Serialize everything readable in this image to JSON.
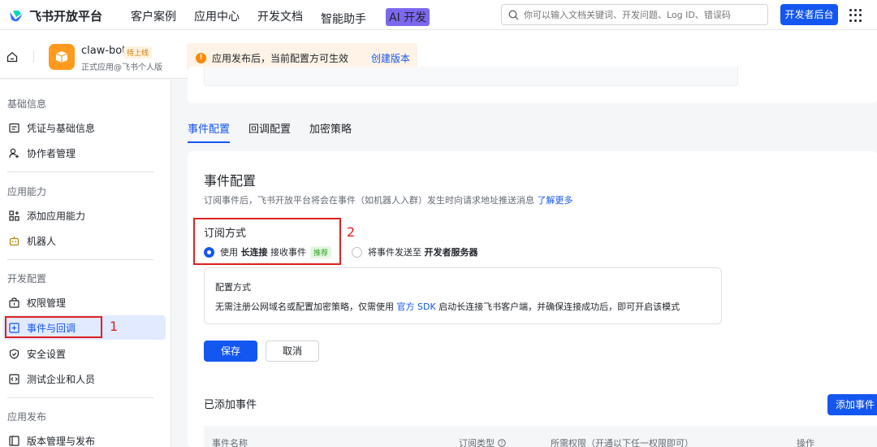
{
  "header": {
    "brand": "飞书开放平台",
    "nav": [
      "客户案例",
      "应用中心",
      "开发文档",
      "智能助手"
    ],
    "ai_badge": "AI 开发",
    "search_placeholder": "你可以输入文档关键词、开发问题、Log ID、错误码",
    "dev_console": "开发者后台"
  },
  "app": {
    "name": "claw-bot",
    "status": "待上线",
    "subtitle": "正式应用@飞书个人版",
    "notice": "应用发布后，当前配置方可生效",
    "notice_link": "创建版本"
  },
  "sidebar": {
    "groups": [
      {
        "title": "基础信息",
        "items": [
          "凭证与基础信息",
          "协作者管理"
        ]
      },
      {
        "title": "应用能力",
        "items": [
          "添加应用能力",
          "机器人"
        ]
      },
      {
        "title": "开发配置",
        "items": [
          "权限管理",
          "事件与回调",
          "安全设置",
          "测试企业和人员"
        ]
      },
      {
        "title": "应用发布",
        "items": [
          "版本管理与发布"
        ]
      }
    ],
    "active": "事件与回调",
    "marker": "1"
  },
  "tabs": [
    "事件配置",
    "回调配置",
    "加密策略"
  ],
  "event_config": {
    "title": "事件配置",
    "desc": "订阅事件后，飞书开放平台将会在事件（如机器人入群）发生时向请求地址推送消息",
    "learn_more": "了解更多",
    "subscribe_label": "订阅方式",
    "marker": "2",
    "option1_prefix": "使用",
    "option1_bold": "长连接",
    "option1_suffix": "接收事件",
    "option1_badge": "推荐",
    "option2_prefix": "将事件发送至",
    "option2_bold": "开发者服务器",
    "config_title": "配置方式",
    "config_desc_a": "无需注册公网域名或配置加密策略，仅需使用",
    "config_link": "官方 SDK",
    "config_desc_b": "启动长连接飞书客户端，并确保连接成功后，即可开启该模式",
    "save": "保存",
    "cancel": "取消"
  },
  "added_events": {
    "title": "已添加事件",
    "add_button": "添加事件",
    "columns": [
      "事件名称",
      "订阅类型",
      "所需权限（开通以下任一权限即可）",
      "操作"
    ]
  },
  "colors": {
    "primary": "#1456f0",
    "annotation": "#e02020",
    "app_icon": "#ff9a1f"
  }
}
